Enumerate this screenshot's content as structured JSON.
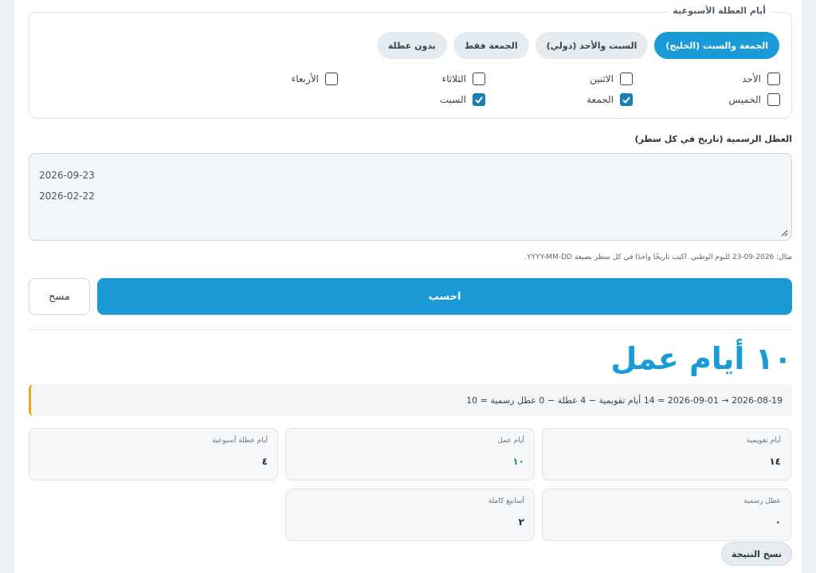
{
  "weekend": {
    "legend": "أيام العطلة الأسبوعية",
    "presets": [
      {
        "label": "الجمعة والسبت (الخليج)",
        "active": true
      },
      {
        "label": "السبت والأحد (دولي)",
        "active": false
      },
      {
        "label": "الجمعة فقط",
        "active": false
      },
      {
        "label": "بدون عطلة",
        "active": false
      }
    ],
    "days": [
      {
        "label": "الأحد",
        "checked": false
      },
      {
        "label": "الاثنين",
        "checked": false
      },
      {
        "label": "الثلاثاء",
        "checked": false
      },
      {
        "label": "الأربعاء",
        "checked": false
      },
      {
        "label": "الخميس",
        "checked": false
      },
      {
        "label": "الجمعة",
        "checked": true
      },
      {
        "label": "السبت",
        "checked": true
      }
    ]
  },
  "holidays": {
    "label": "العطل الرسمية (تاريخ في كل سطر)",
    "lines": [
      "2026-09-23",
      "2026-02-22"
    ],
    "hint": "مثال: 2026-09-23 لليوم الوطني. اكتب تاريخًا واحدًا في كل سطر بصيغة YYYY-MM-DD."
  },
  "actions": {
    "calculate": "احسب",
    "clear": "مسح",
    "copy": "نسخ النتيجة"
  },
  "result": {
    "title": "١٠ أيام عمل",
    "formula": "2026-08-19 → 2026-09-01 = 14 أيام تقويمية − 4 عطلة − 0 عطل رسمية = 10",
    "stats": {
      "calendar_days": {
        "label": "أيام تقويمية",
        "value": "١٤"
      },
      "work_days": {
        "label": "أيام عمل",
        "value": "١٠"
      },
      "weekend_days": {
        "label": "أيام عطلة أسبوعية",
        "value": "٤"
      },
      "public_holidays": {
        "label": "عطل رسمية",
        "value": "٠"
      },
      "full_weeks": {
        "label": "أسابيع كاملة",
        "value": "٢"
      }
    }
  },
  "colors": {
    "accent": "#1a9bd7",
    "success": "#1e9a3e",
    "warning": "#f0a818"
  }
}
